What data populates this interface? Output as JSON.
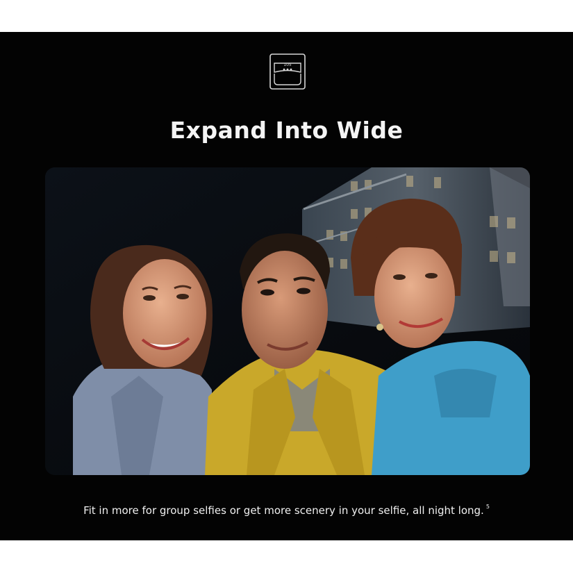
{
  "hero": {
    "icon": {
      "name": "wide-angle-lens-icon",
      "label": "105"
    },
    "title": "Expand Into Wide",
    "photo": {
      "subject": "group-selfie-night"
    },
    "caption": {
      "text": "Fit in more for group selfies or get more scenery in your selfie, all night long.",
      "footnote": "5"
    }
  },
  "colors": {
    "background": "#030303",
    "text": "#f4f4f4",
    "page": "#ffffff"
  }
}
